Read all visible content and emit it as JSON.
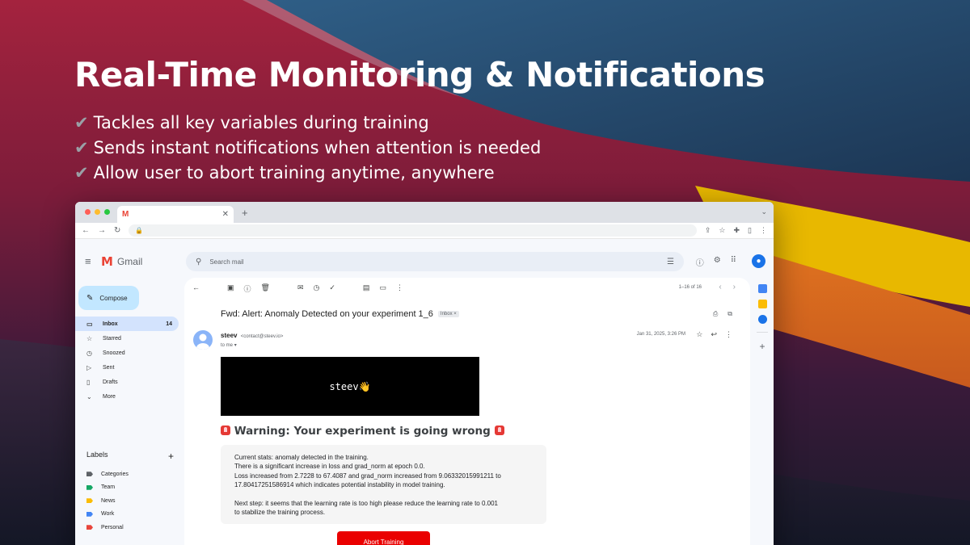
{
  "hero": {
    "title": "Real-Time Monitoring & Notifications",
    "features": [
      "Tackles all key variables during training",
      "Sends instant notifications when attention is needed",
      "Allow user to abort training anytime, anywhere"
    ]
  },
  "browser": {
    "tab_logo": "M"
  },
  "gmail": {
    "logo_text": "Gmail",
    "search_placeholder": "Search mail",
    "compose_label": "Compose",
    "nav": [
      {
        "label": "Inbox",
        "icon": "inbox-icon",
        "count": "14",
        "active": true
      },
      {
        "label": "Starred",
        "icon": "star-icon"
      },
      {
        "label": "Snoozed",
        "icon": "clock-icon"
      },
      {
        "label": "Sent",
        "icon": "send-icon"
      },
      {
        "label": "Drafts",
        "icon": "draft-icon"
      },
      {
        "label": "More",
        "icon": "chevron-down-icon"
      }
    ],
    "labels_heading": "Labels",
    "labels": [
      {
        "label": "Categories",
        "color": "#5f6368"
      },
      {
        "label": "Team",
        "color": "#16a765"
      },
      {
        "label": "News",
        "color": "#fbbc04"
      },
      {
        "label": "Work",
        "color": "#4285f4"
      },
      {
        "label": "Personal",
        "color": "#e8453c"
      }
    ],
    "pager": "1–16 of 16"
  },
  "email": {
    "subject": "Fwd: Alert: Anomaly Detected on your experiment 1_6",
    "inbox_chip": "Inbox ×",
    "sender_name": "steev",
    "sender_email": "<contact@steev.io>",
    "to": "to me",
    "date": "Jan 31, 2025, 3:26 PM",
    "banner_text": "steev👋",
    "warning": "Warning: Your experiment is going wrong",
    "stats_lines": [
      "Current stats: anomaly detected in the training.",
      "There is a significant increase in loss and grad_norm at epoch 0.0.",
      "Loss increased from 2.7228 to 67.4087 and grad_norm increased from 9.06332015991211 to",
      "17.80417251586914 which indicates potential instability in model training."
    ],
    "next_step_lines": [
      "Next step: it seems that the learning rate is too high please reduce the learning rate to 0.001",
      "to stabilize the training process."
    ],
    "abort_button": "Abort Training"
  }
}
